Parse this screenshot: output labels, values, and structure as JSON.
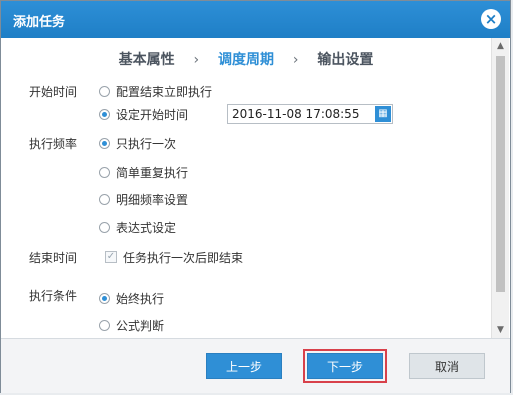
{
  "dialog": {
    "title": "添加任务",
    "close_icon": "×"
  },
  "steps": {
    "items": [
      "基本属性",
      "调度周期",
      "输出设置"
    ],
    "active_index": 1,
    "separator": "›"
  },
  "form": {
    "start_time": {
      "label": "开始时间",
      "options": [
        "配置结束立即执行",
        "设定开始时间"
      ],
      "selected": "设定开始时间",
      "datetime_value": "2016-11-08 17:08:55"
    },
    "frequency": {
      "label": "执行频率",
      "options": [
        "只执行一次",
        "简单重复执行",
        "明细频率设置",
        "表达式设定"
      ],
      "selected": "只执行一次"
    },
    "end_time": {
      "label": "结束时间",
      "checkbox_label": "任务执行一次后即结束",
      "checked": true
    },
    "condition": {
      "label": "执行条件",
      "options": [
        "始终执行",
        "公式判断"
      ],
      "selected": "始终执行"
    }
  },
  "footer": {
    "prev_label": "上一步",
    "next_label": "下一步",
    "cancel_label": "取消"
  },
  "colors": {
    "title_bar": "#1f7fc6",
    "accent": "#2f8fd6",
    "focus_outline": "#d8414b"
  }
}
